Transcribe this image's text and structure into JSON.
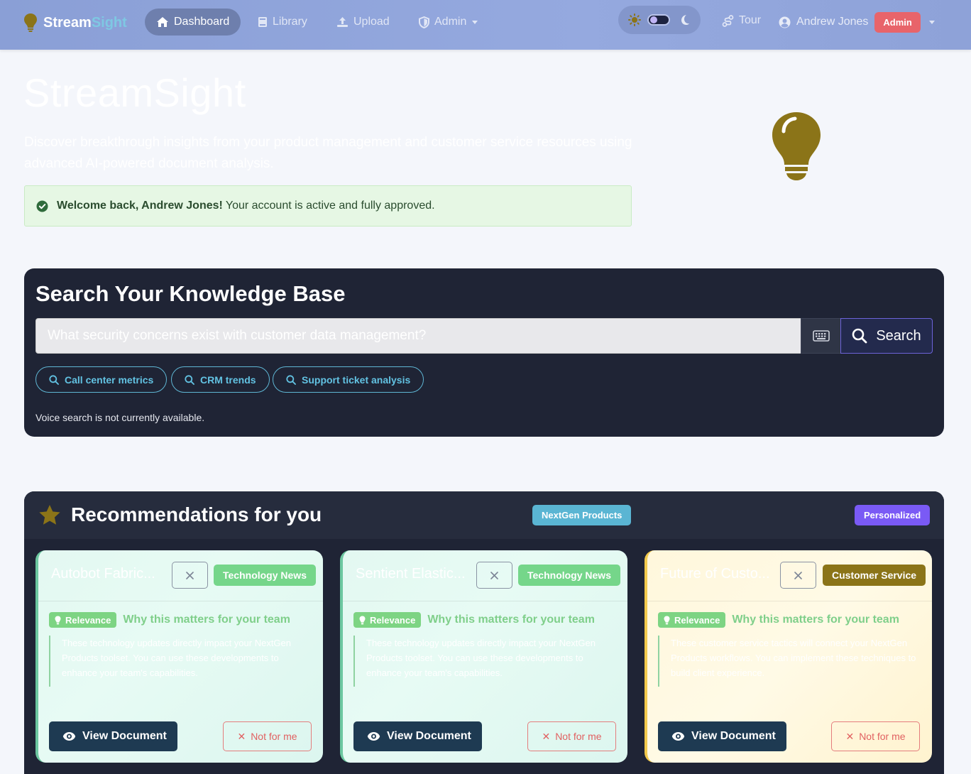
{
  "nav": {
    "brand_part1": "Stream",
    "brand_part2": "Sight",
    "items": [
      {
        "label": "Dashboard",
        "icon": "home-icon",
        "active": true
      },
      {
        "label": "Library",
        "icon": "book-icon"
      },
      {
        "label": "Upload",
        "icon": "upload-icon"
      },
      {
        "label": "Admin",
        "icon": "shield-icon",
        "dropdown": true
      }
    ],
    "tour_label": "Tour",
    "user_name": "Andrew Jones",
    "role_badge": "Admin"
  },
  "hero": {
    "title": "StreamSight",
    "subtitle": "Discover breakthrough insights from your product management and customer service resources using advanced AI-powered document analysis.",
    "welcome_bold": "Welcome back, Andrew Jones!",
    "welcome_text": "Your account is active and fully approved."
  },
  "search": {
    "title": "Search Your Knowledge Base",
    "placeholder": "What security concerns exist with customer data management?",
    "button_label": "Search",
    "chips": [
      "Call center metrics",
      "CRM trends",
      "Support ticket analysis"
    ],
    "voice_note": "Voice search is not currently available."
  },
  "recommendations": {
    "title": "Recommendations for you",
    "badge_product": "NextGen Products",
    "badge_personalized": "Personalized",
    "relevance_label": "Relevance",
    "relevance_heading": "Why this matters for your team",
    "view_label": "View Document",
    "notme_label": "Not for me",
    "cards": [
      {
        "title": "Autobot Fabric...",
        "category": "Technology News",
        "body": "These technology updates directly impact your NextGen Products toolset. You can use these developments to enhance your team's capabilities."
      },
      {
        "title": "Sentient Elastic...",
        "category": "Technology News",
        "body": "These technology updates directly impact your NextGen Products toolset. You can use these developments to enhance your team's capabilities."
      },
      {
        "title": "Future of Custo...",
        "category": "Customer Service",
        "body": "These customer service tactics will connect your NextGen Products workflows. You can implement these techniques to build client experience."
      }
    ]
  },
  "colors": {
    "nav_gradient": "#8a9fd6",
    "panel_bg": "#1f2435",
    "accent_teal": "#5ab5d3",
    "accent_purple": "#7a5af5",
    "relevance_green": "#7dd483",
    "olive": "#8b7418"
  }
}
